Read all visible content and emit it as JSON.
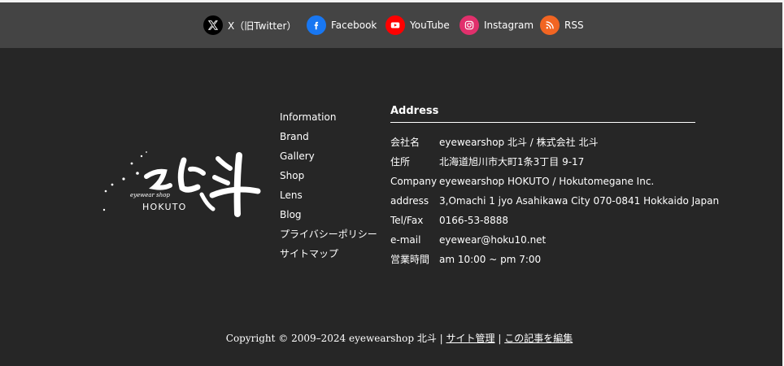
{
  "social": {
    "x": "X（旧Twitter）",
    "facebook": "Facebook",
    "youtube": "YouTube",
    "instagram": "Instagram",
    "rss": "RSS"
  },
  "logo": {
    "small": "eyewear shop",
    "main": "HOKUTO",
    "alt": "北斗"
  },
  "nav": [
    "Information",
    "Brand",
    "Gallery",
    "Shop",
    "Lens",
    "Blog",
    "プライバシーポリシー",
    "サイトマップ"
  ],
  "address": {
    "title": "Address",
    "rows": [
      {
        "label": "会社名",
        "value": "eyewearshop 北斗 / 株式会社 北斗"
      },
      {
        "label": "住所",
        "value": "北海道旭川市大町1条3丁目 9-17"
      },
      {
        "label": "Company",
        "value": "eyewearshop HOKUTO / Hokutomegane Inc."
      },
      {
        "label": "address",
        "value": "3,Omachi 1 jyo Asahikawa City 070-0841 Hokkaido Japan"
      },
      {
        "label": "Tel/Fax",
        "value": "0166-53-8888"
      },
      {
        "label": "e-mail",
        "value": "eyewear@hoku10.net"
      },
      {
        "label": "営業時間",
        "value": "am 10:00 ~ pm 7:00"
      }
    ]
  },
  "copyright": {
    "text": "Copyright © 2009–2024 eyewearshop 北斗",
    "sep": " | ",
    "site_admin": "サイト管理",
    "edit_post": "この記事を編集"
  },
  "colors": {
    "background": "#262626",
    "social_bar": "#444444",
    "facebook": "#1877f2",
    "youtube": "#ff0000",
    "instagram": "#e1306c",
    "rss": "#f26522",
    "x": "#000000"
  }
}
